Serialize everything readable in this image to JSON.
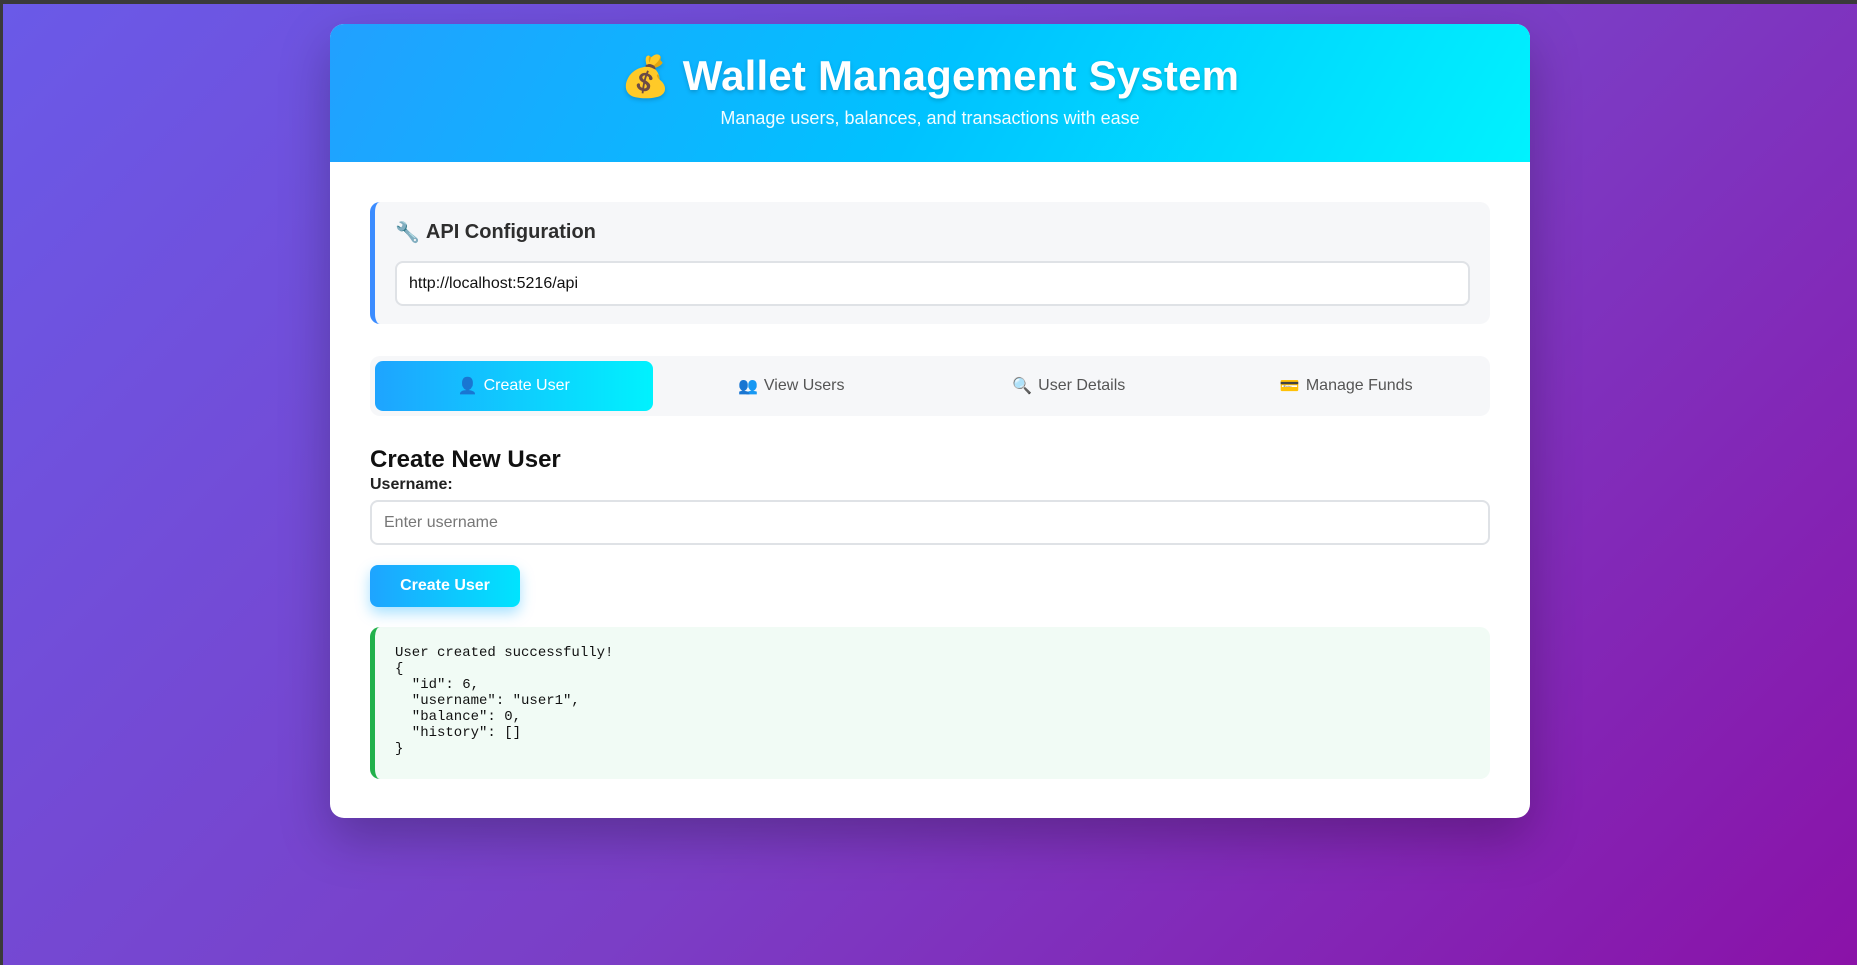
{
  "header": {
    "icon": "money-bag-icon",
    "icon_glyph": "💰",
    "title": "Wallet Management System",
    "subtitle": "Manage users, balances, and transactions with ease"
  },
  "api_config": {
    "icon": "wrench-icon",
    "icon_glyph": "🔧",
    "title": "API Configuration",
    "url_value": "http://localhost:5216/api"
  },
  "tabs": [
    {
      "icon": "user-icon",
      "icon_glyph": "👤",
      "label": "Create User",
      "active": true
    },
    {
      "icon": "users-icon",
      "icon_glyph": "👥",
      "label": "View Users",
      "active": false
    },
    {
      "icon": "search-icon",
      "icon_glyph": "🔍",
      "label": "User Details",
      "active": false
    },
    {
      "icon": "credit-card-icon",
      "icon_glyph": "💳",
      "label": "Manage Funds",
      "active": false
    }
  ],
  "create_user": {
    "heading": "Create New User",
    "username_label": "Username:",
    "username_placeholder": "Enter username",
    "button_label": "Create User"
  },
  "result": {
    "text": "User created successfully!\n{\n  \"id\": 6,\n  \"username\": \"user1\",\n  \"balance\": 0,\n  \"history\": []\n}"
  },
  "colors": {
    "accent_start": "#1ea4ff",
    "accent_end": "#00f2fe",
    "success_border": "#22b14c",
    "api_border": "#3b8cff"
  }
}
